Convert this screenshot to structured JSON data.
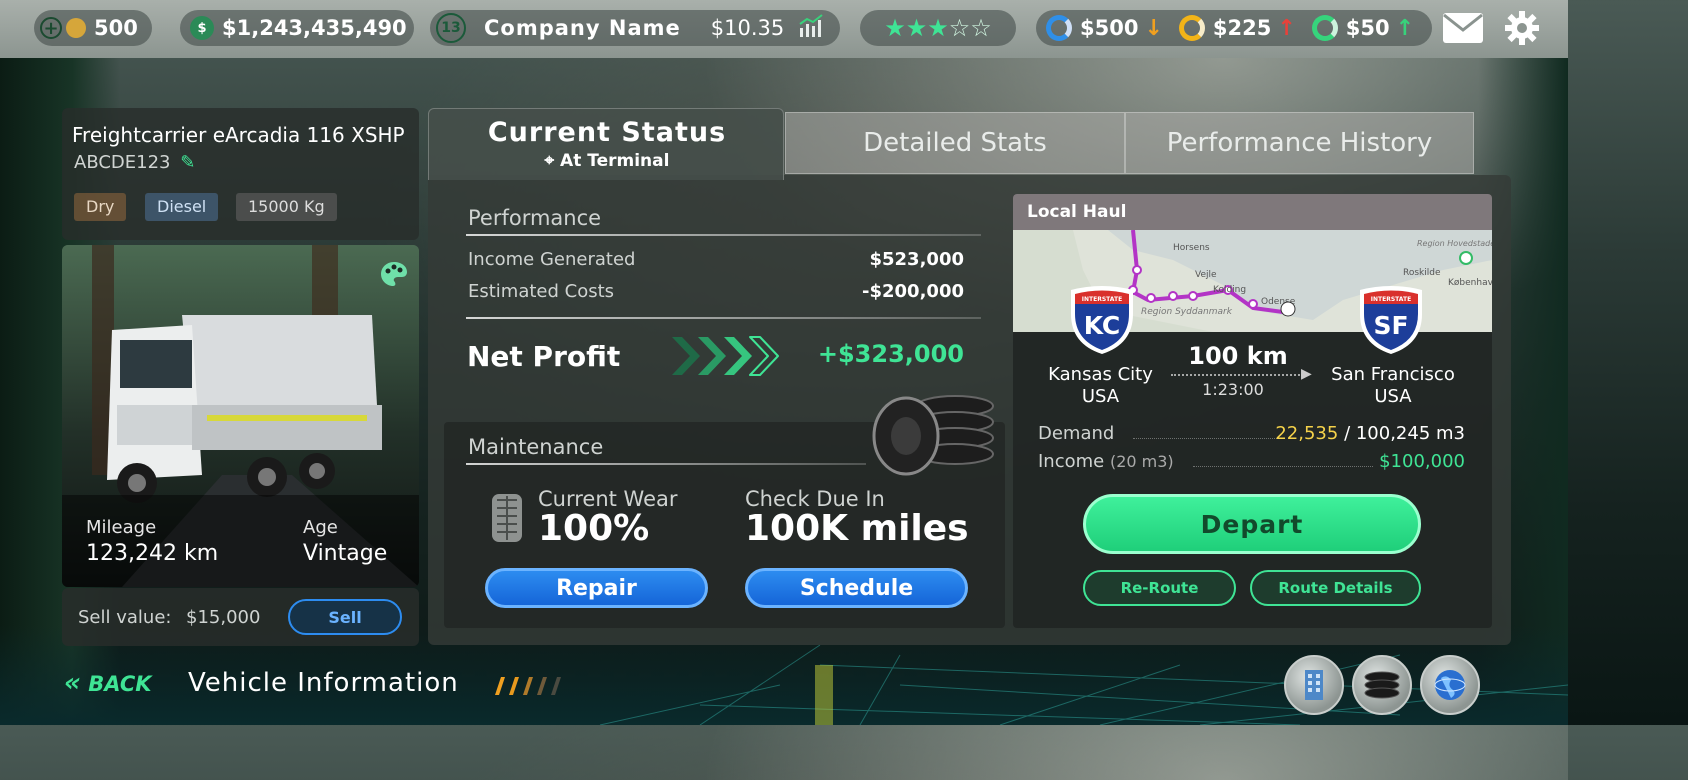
{
  "topbar": {
    "gold_amount": "500",
    "cash": "$1,243,435,490",
    "company_level": "13",
    "company_name": "Company Name",
    "share_price": "$10.35",
    "rating_stars": 3,
    "rating_max": 5,
    "res1": {
      "value": "$500",
      "trend": "↓",
      "ring_color": "#2f8fe8"
    },
    "res2": {
      "value": "$225",
      "trend": "↑",
      "ring_color": "#f2b418"
    },
    "res3": {
      "value": "$50",
      "trend": "↑",
      "ring_color": "#36d47c"
    }
  },
  "vehicle": {
    "name": "Freightcarrier eArcadia 116 XSHP",
    "plate": "ABCDE123",
    "tags": [
      "Dry",
      "Diesel",
      "15000 Kg"
    ],
    "mileage_label": "Mileage",
    "mileage_value": "123,242 km",
    "age_label": "Age",
    "age_value": "Vintage",
    "sell_label": "Sell value:",
    "sell_value": "$15,000",
    "sell_button": "Sell"
  },
  "tabs": {
    "current_status": "Current Status",
    "current_status_sub": "At Terminal",
    "detailed_stats": "Detailed Stats",
    "performance_history": "Performance History"
  },
  "performance": {
    "heading": "Performance",
    "income_label": "Income Generated",
    "income_value": "$523,000",
    "costs_label": "Estimated Costs",
    "costs_value": "-$200,000",
    "net_label": "Net Profit",
    "net_value": "+$323,000"
  },
  "maintenance": {
    "heading": "Maintenance",
    "wear_label": "Current Wear",
    "wear_value": "100%",
    "due_label": "Check Due In",
    "due_value": "100K miles",
    "repair_button": "Repair",
    "schedule_button": "Schedule"
  },
  "route": {
    "type": "Local Haul",
    "from_code": "KC",
    "from_city": "Kansas City",
    "from_country": "USA",
    "to_code": "SF",
    "to_city": "San Francisco",
    "to_country": "USA",
    "distance": "100 km",
    "duration": "1:23:00",
    "shield_label": "INTERSTATE",
    "map_labels": [
      "Horsens",
      "Vejle",
      "Kolding",
      "Odense",
      "Region Syddanmark",
      "Roskilde",
      "København",
      "Region Hovedstaden"
    ],
    "demand_label": "Demand",
    "demand_current": "22,535",
    "demand_total": "/ 100,245 m3",
    "income_label": "Income",
    "income_qty": "(20 m3)",
    "income_value": "$100,000",
    "depart_button": "Depart",
    "reroute_button": "Re-Route",
    "details_button": "Route Details"
  },
  "footer": {
    "back_label": "BACK",
    "screen_title": "Vehicle Information"
  },
  "colors": {
    "accent_green": "#3fe495",
    "accent_blue": "#1d74e6",
    "demand_yellow": "#f5d24a"
  }
}
